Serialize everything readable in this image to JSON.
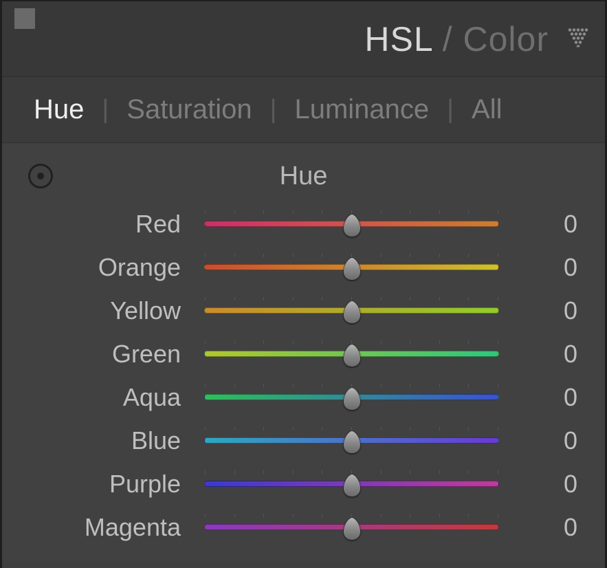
{
  "header": {
    "title_primary": "HSL",
    "title_separator": "/",
    "title_secondary": "Color"
  },
  "tabs": {
    "items": [
      "Hue",
      "Saturation",
      "Luminance",
      "All"
    ],
    "active_index": 0
  },
  "section": {
    "title": "Hue"
  },
  "sliders": [
    {
      "label": "Red",
      "value": 0,
      "gradient": "grad-red"
    },
    {
      "label": "Orange",
      "value": 0,
      "gradient": "grad-orange"
    },
    {
      "label": "Yellow",
      "value": 0,
      "gradient": "grad-yellow"
    },
    {
      "label": "Green",
      "value": 0,
      "gradient": "grad-green"
    },
    {
      "label": "Aqua",
      "value": 0,
      "gradient": "grad-aqua"
    },
    {
      "label": "Blue",
      "value": 0,
      "gradient": "grad-blue"
    },
    {
      "label": "Purple",
      "value": 0,
      "gradient": "grad-purple"
    },
    {
      "label": "Magenta",
      "value": 0,
      "gradient": "grad-magenta"
    }
  ]
}
